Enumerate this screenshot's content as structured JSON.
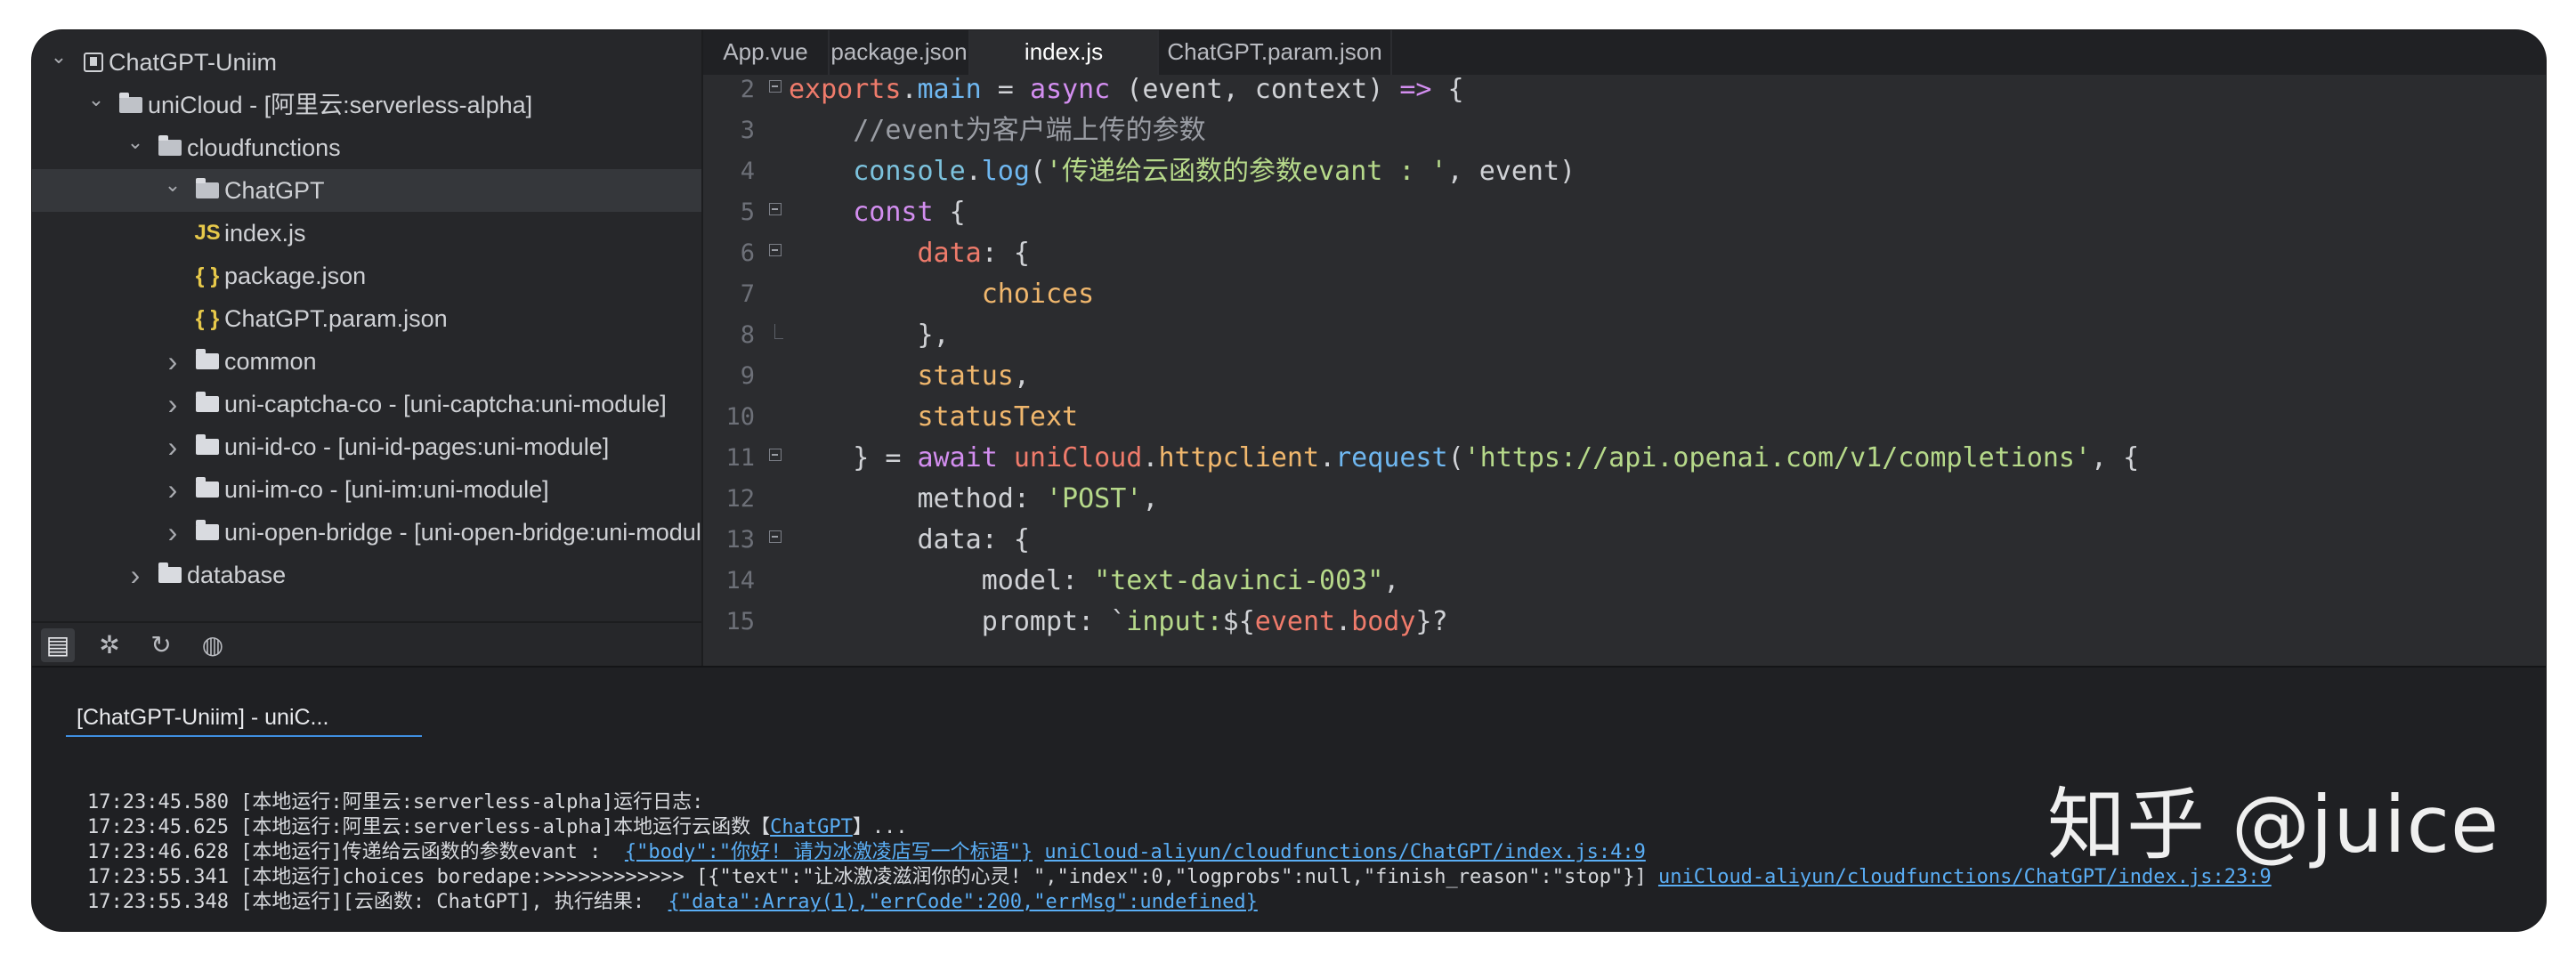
{
  "sidebar": {
    "tree": [
      {
        "label": "ChatGPT-Uniim",
        "type": "project",
        "chevron": "down"
      },
      {
        "label": "uniCloud - [阿里云:serverless-alpha]",
        "type": "folder-open",
        "chevron": "down"
      },
      {
        "label": "cloudfunctions",
        "type": "folder-open",
        "chevron": "down"
      },
      {
        "label": "ChatGPT",
        "type": "folder-open",
        "chevron": "down",
        "selected": true
      },
      {
        "label": "index.js",
        "type": "js"
      },
      {
        "label": "package.json",
        "type": "json"
      },
      {
        "label": "ChatGPT.param.json",
        "type": "json"
      },
      {
        "label": "common",
        "type": "folder",
        "chevron": "right"
      },
      {
        "label": "uni-captcha-co - [uni-captcha:uni-module]",
        "type": "folder",
        "chevron": "right"
      },
      {
        "label": "uni-id-co - [uni-id-pages:uni-module]",
        "type": "folder",
        "chevron": "right"
      },
      {
        "label": "uni-im-co - [uni-im:uni-module]",
        "type": "folder",
        "chevron": "right"
      },
      {
        "label": "uni-open-bridge - [uni-open-bridge:uni-module]",
        "type": "folder",
        "chevron": "right"
      },
      {
        "label": "database",
        "type": "folder",
        "chevron": "right"
      }
    ],
    "icons": {
      "js": "JS",
      "json": "{ }",
      "chev_down": "⌄",
      "chev_right": "›"
    },
    "bottom_buttons": [
      {
        "name": "files-icon",
        "glyph": "▤"
      },
      {
        "name": "bug-icon",
        "glyph": "✲"
      },
      {
        "name": "refresh-icon",
        "glyph": "↻"
      },
      {
        "name": "globe-icon",
        "glyph": "◍"
      }
    ]
  },
  "tabs": [
    "App.vue",
    "package.json",
    "index.js",
    "ChatGPT.param.json"
  ],
  "active_tab": "index.js",
  "editor": {
    "lines": [
      {
        "n": "2",
        "fold": "start",
        "tokens": [
          [
            "red",
            "exports"
          ],
          [
            "id",
            "."
          ],
          [
            "fn",
            "main"
          ],
          [
            "id",
            " = "
          ],
          [
            "kw",
            "async"
          ],
          [
            "id",
            " (event, context) "
          ],
          [
            "kw",
            "=>"
          ],
          [
            "id",
            " {"
          ]
        ]
      },
      {
        "n": "3",
        "tokens": [
          [
            "id",
            "    "
          ],
          [
            "cm",
            "//event为客户端上传的参数"
          ]
        ]
      },
      {
        "n": "4",
        "tokens": [
          [
            "id",
            "    "
          ],
          [
            "con",
            "console"
          ],
          [
            "id",
            "."
          ],
          [
            "fn",
            "log"
          ],
          [
            "id",
            "("
          ],
          [
            "str",
            "'传递给云函数的参数evant : '"
          ],
          [
            "id",
            ", event)"
          ]
        ]
      },
      {
        "n": "5",
        "fold": "start",
        "tokens": [
          [
            "id",
            "    "
          ],
          [
            "kw",
            "const"
          ],
          [
            "id",
            " {"
          ]
        ]
      },
      {
        "n": "6",
        "fold": "start",
        "tokens": [
          [
            "id",
            "        "
          ],
          [
            "red",
            "data"
          ],
          [
            "id",
            ": {"
          ]
        ]
      },
      {
        "n": "7",
        "tokens": [
          [
            "id",
            "            "
          ],
          [
            "prop",
            "choices"
          ]
        ]
      },
      {
        "n": "8",
        "fold": "end",
        "tokens": [
          [
            "id",
            "        },"
          ]
        ]
      },
      {
        "n": "9",
        "tokens": [
          [
            "id",
            "        "
          ],
          [
            "prop",
            "status"
          ],
          [
            "id",
            ","
          ]
        ]
      },
      {
        "n": "10",
        "tokens": [
          [
            "id",
            "        "
          ],
          [
            "prop",
            "statusText"
          ]
        ]
      },
      {
        "n": "11",
        "fold": "start",
        "tokens": [
          [
            "id",
            "    } = "
          ],
          [
            "kw",
            "await"
          ],
          [
            "id",
            " "
          ],
          [
            "red",
            "uniCloud"
          ],
          [
            "id",
            "."
          ],
          [
            "prop",
            "httpclient"
          ],
          [
            "id",
            "."
          ],
          [
            "fn",
            "request"
          ],
          [
            "id",
            "("
          ],
          [
            "str",
            "'https://api.openai.com/v1/completions'"
          ],
          [
            "id",
            ", {"
          ]
        ]
      },
      {
        "n": "12",
        "tokens": [
          [
            "id",
            "        method: "
          ],
          [
            "str",
            "'POST'"
          ],
          [
            "id",
            ","
          ]
        ]
      },
      {
        "n": "13",
        "fold": "start",
        "tokens": [
          [
            "id",
            "        data: {"
          ]
        ]
      },
      {
        "n": "14",
        "tokens": [
          [
            "id",
            "            model: "
          ],
          [
            "str",
            "\"text-davinci-003\""
          ],
          [
            "id",
            ","
          ]
        ]
      },
      {
        "n": "15",
        "tokens": [
          [
            "id",
            "            prompt: `"
          ],
          [
            "str",
            "input:"
          ],
          [
            "id",
            "${"
          ],
          [
            "red",
            "event"
          ],
          [
            "id",
            "."
          ],
          [
            "red",
            "body"
          ],
          [
            "id",
            "}?"
          ]
        ]
      }
    ]
  },
  "console": {
    "tab_title": "[ChatGPT-Uniim] - uniC...",
    "logs": [
      [
        [
          "t",
          "17:23:45.580 [本地运行:阿里云:serverless-alpha]运行日志:"
        ]
      ],
      [
        [
          "t",
          "17:23:45.625 [本地运行:阿里云:serverless-alpha]本地运行云函数【"
        ],
        [
          "l",
          "ChatGPT"
        ],
        [
          "t",
          "】..."
        ]
      ],
      [
        [
          "t",
          "17:23:46.628 [本地运行]传递给云函数的参数evant :  "
        ],
        [
          "l",
          "{\"body\":\"你好! 请为冰激凌店写一个标语\"}"
        ],
        [
          "t",
          " "
        ],
        [
          "l",
          "uniCloud-aliyun/cloudfunctions/ChatGPT/index.js:4:9"
        ]
      ],
      [
        [
          "t",
          "17:23:55.341 [本地运行]choices boredape:>>>>>>>>>>>> [{\"text\":\"让冰激凌滋润你的心灵! \",\"index\":0,\"logprobs\":null,\"finish_reason\":\"stop\"}] "
        ],
        [
          "l",
          "uniCloud-aliyun/cloudfunctions/ChatGPT/index.js:23:9"
        ]
      ],
      [
        [
          "t",
          "17:23:55.348 [本地运行][云函数: ChatGPT], 执行结果:  "
        ],
        [
          "l",
          "{\"data\":Array(1),\"errCode\":200,\"errMsg\":undefined}"
        ]
      ]
    ]
  },
  "watermark": "知乎 @juice"
}
